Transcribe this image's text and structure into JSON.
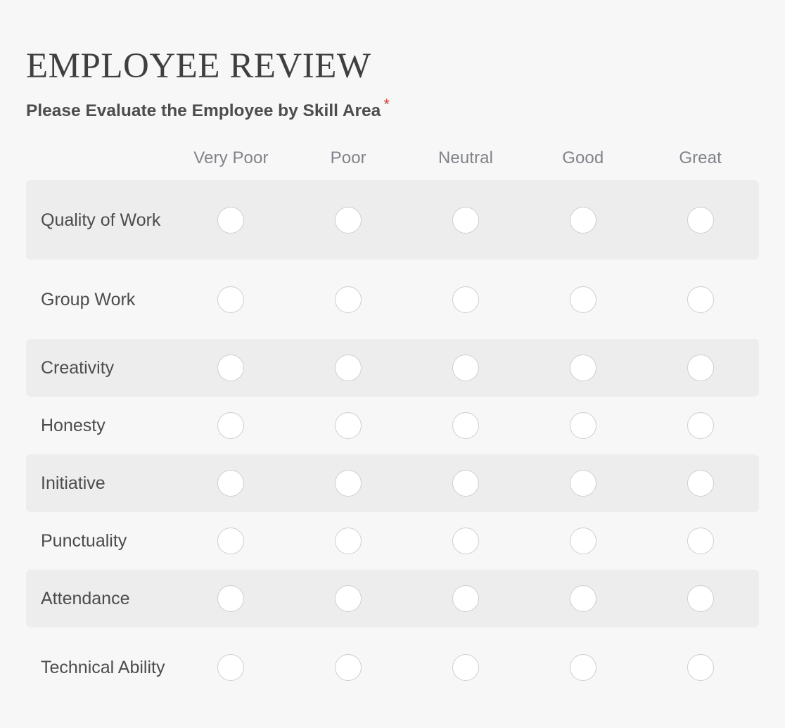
{
  "form": {
    "title": "EMPLOYEE REVIEW",
    "question_label": "Please Evaluate the Employee by Skill Area",
    "required_marker": "*",
    "required_color": "#c9463c"
  },
  "matrix": {
    "columns": [
      {
        "label": "Very Poor"
      },
      {
        "label": "Poor"
      },
      {
        "label": "Neutral"
      },
      {
        "label": "Good"
      },
      {
        "label": "Great"
      }
    ],
    "rows": [
      {
        "label": "Quality of Work",
        "striped": true,
        "tall": true,
        "selected": null
      },
      {
        "label": "Group Work",
        "striped": false,
        "tall": true,
        "selected": null
      },
      {
        "label": "Creativity",
        "striped": true,
        "tall": false,
        "selected": null
      },
      {
        "label": "Honesty",
        "striped": false,
        "tall": false,
        "selected": null
      },
      {
        "label": "Initiative",
        "striped": true,
        "tall": false,
        "selected": null
      },
      {
        "label": "Punctuality",
        "striped": false,
        "tall": false,
        "selected": null
      },
      {
        "label": "Attendance",
        "striped": true,
        "tall": false,
        "selected": null
      },
      {
        "label": "Technical Ability",
        "striped": false,
        "tall": true,
        "selected": null
      }
    ]
  }
}
